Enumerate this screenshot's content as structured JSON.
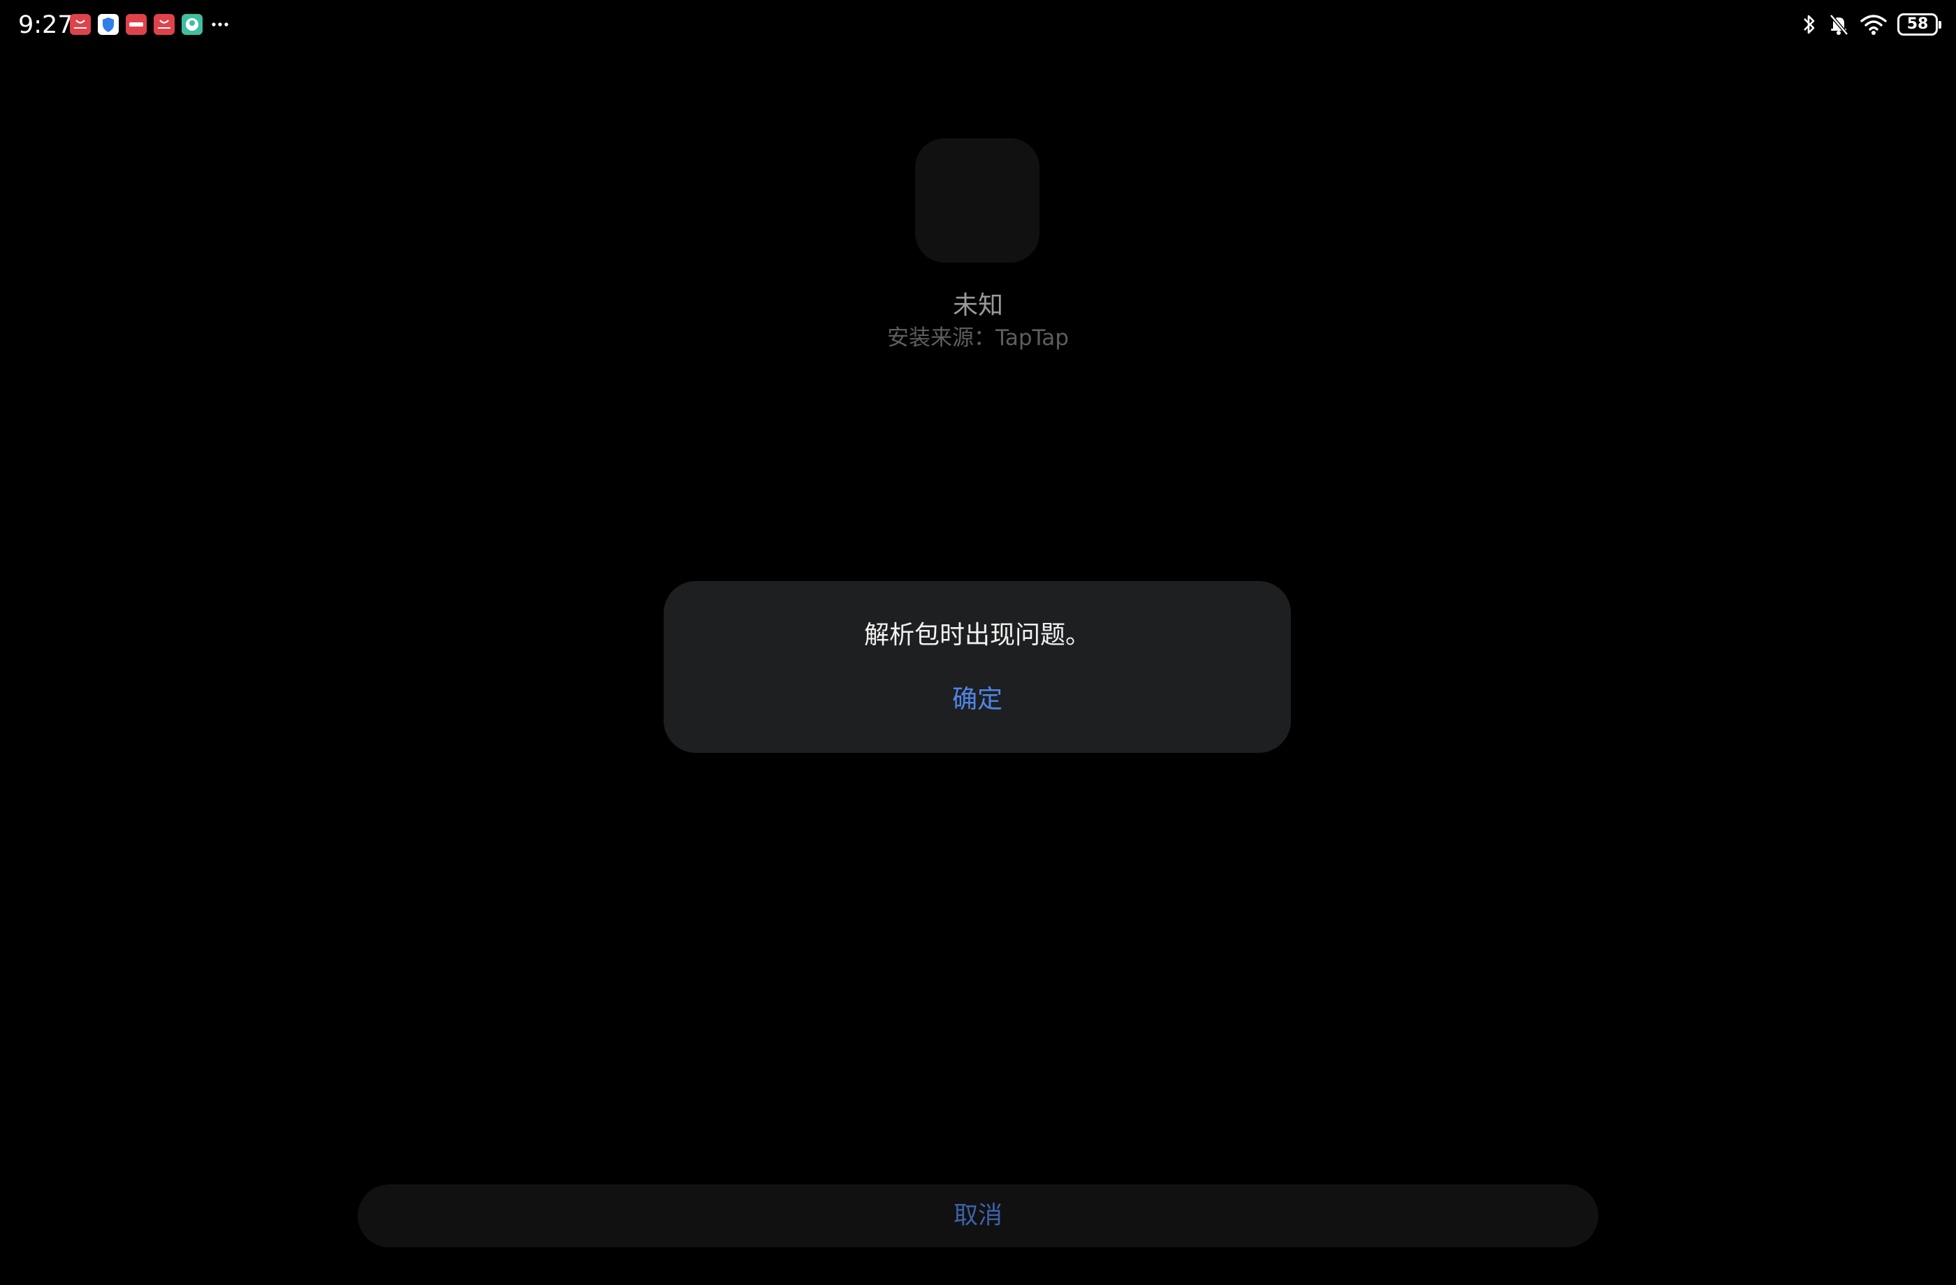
{
  "status_bar": {
    "time": "9:27",
    "battery_level": "58",
    "notification_icons": [
      {
        "name": "app-store-icon",
        "color": "#e0424b"
      },
      {
        "name": "shield-icon",
        "color": "#ffffff"
      },
      {
        "name": "app-icon-red",
        "color": "#e0424b"
      },
      {
        "name": "app-store-icon-2",
        "color": "#e0424b"
      },
      {
        "name": "teal-app-icon",
        "color": "#3fbf9f"
      }
    ],
    "system_icons": [
      "bluetooth-icon",
      "bell-muted-icon",
      "wifi-icon",
      "battery-icon"
    ]
  },
  "app": {
    "name": "未知",
    "install_source": "安装来源：TapTap"
  },
  "dialog": {
    "message": "解析包时出现问题。",
    "ok_label": "确定",
    "accent_color": "#4e86e6"
  },
  "footer": {
    "cancel_label": "取消"
  }
}
